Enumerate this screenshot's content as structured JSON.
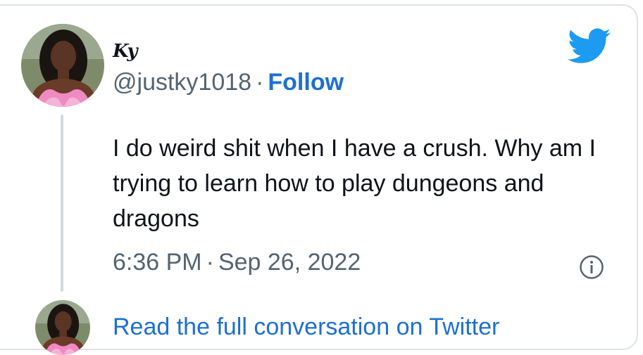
{
  "tweet": {
    "author": {
      "display_name": "Ky",
      "handle": "@justky1018",
      "follow_label": "Follow"
    },
    "text": "I do weird shit when I have a crush. Why am I trying to learn how to play dungeons and dragons",
    "time": "6:36 PM",
    "date": "Sep 26, 2022",
    "separator": "·"
  },
  "footer": {
    "read_link": "Read the full conversation on Twitter"
  },
  "colors": {
    "accent": "#1d6fd6",
    "twitter_blue": "#1d9bf0",
    "secondary_text": "#536471",
    "thread_line": "#cfd9de"
  },
  "icons": {
    "brand": "twitter-bird-icon",
    "info": "info-circle-icon"
  }
}
